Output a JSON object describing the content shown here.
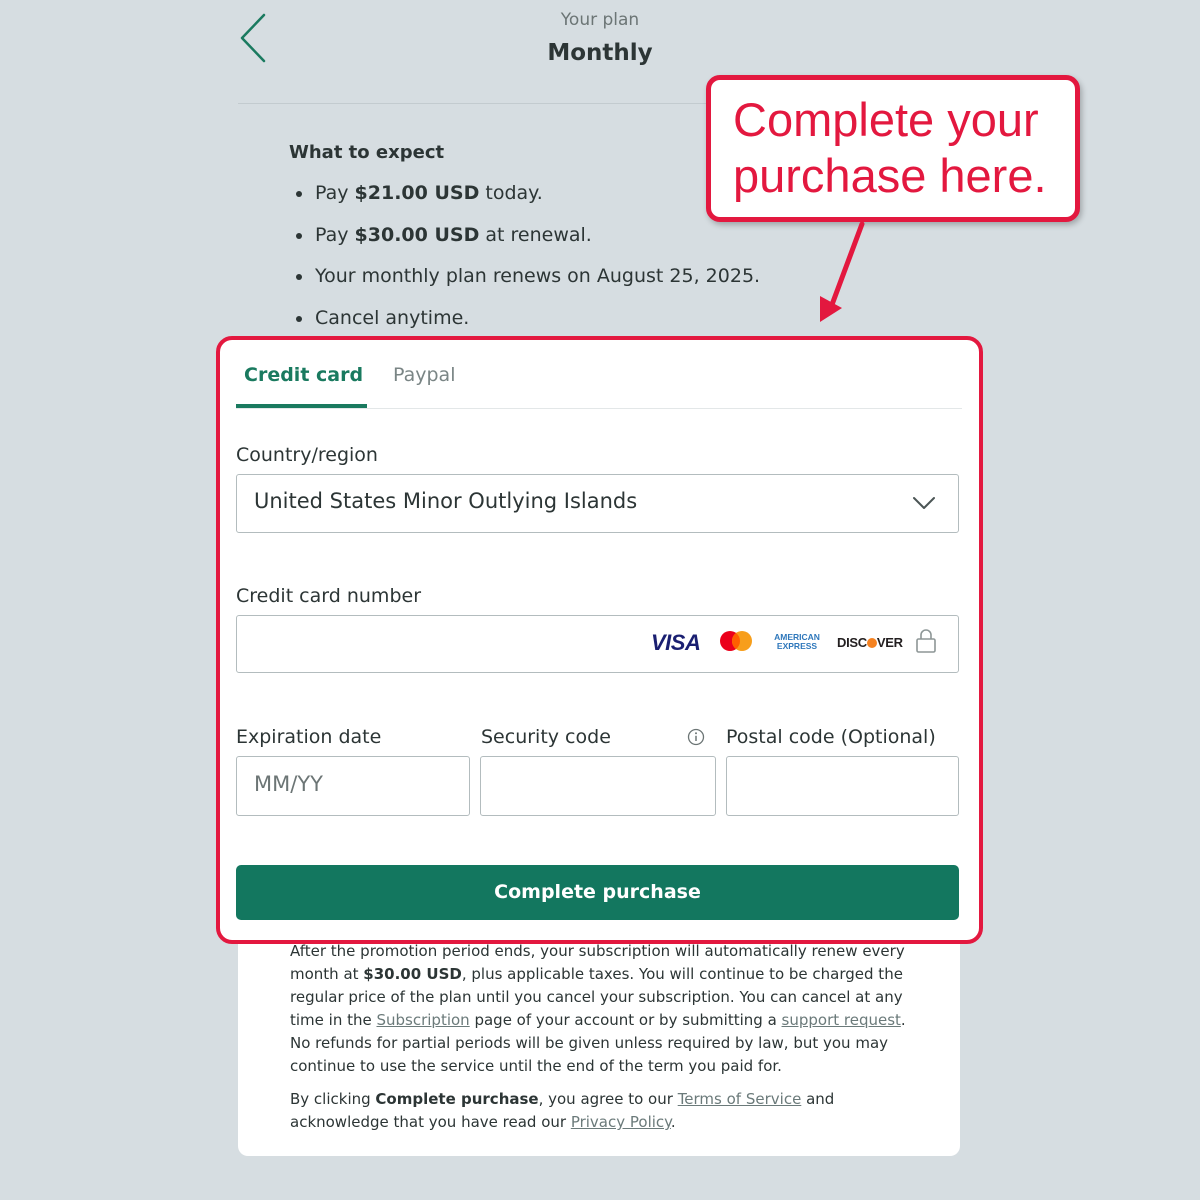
{
  "header": {
    "subtitle": "Your plan",
    "title": "Monthly"
  },
  "expectations": {
    "heading": "What to expect",
    "items": [
      {
        "pre": "Pay ",
        "bold": "$21.00 USD",
        "post": " today."
      },
      {
        "pre": "Pay ",
        "bold": "$30.00 USD",
        "post": " at renewal."
      },
      {
        "pre": "Your monthly plan renews on August 25, 2025.",
        "bold": "",
        "post": ""
      },
      {
        "pre": "Cancel anytime.",
        "bold": "",
        "post": ""
      }
    ]
  },
  "callout": {
    "line1": "Complete your",
    "line2": "purchase here."
  },
  "payment": {
    "tabs": [
      {
        "label": "Credit card",
        "active": true
      },
      {
        "label": "Paypal",
        "active": false
      }
    ],
    "country_label": "Country/region",
    "country_value": "United States Minor Outlying Islands",
    "card_number_label": "Credit card number",
    "card_brands": {
      "visa": "VISA",
      "amex_line1": "AMERICAN",
      "amex_line2": "EXPRESS",
      "discover_pre": "DISC",
      "discover_post": "VER"
    },
    "expiration_label": "Expiration date",
    "expiration_placeholder": "MM/YY",
    "security_label": "Security code",
    "postal_label": "Postal code (Optional)",
    "purchase_button": "Complete purchase"
  },
  "legal": {
    "p1_a": "After the promotion period ends, your subscription will automatically renew every month at ",
    "p1_b": "$30.00 USD",
    "p1_c": ", plus applicable taxes. You will continue to be charged the regular price of the plan until you cancel your subscription. You can cancel at any time in the ",
    "p1_link1": "Subscription",
    "p1_d": " page of your account or by submitting a ",
    "p1_link2": "support request",
    "p1_e": ". No refunds for partial periods will be given unless required by law, but you may continue to use the service until the end of the term you paid for.",
    "p2_a": "By clicking ",
    "p2_b": "Complete purchase",
    "p2_c": ", you agree to our ",
    "p2_link1": "Terms of Service",
    "p2_d": " and acknowledge that you have read our ",
    "p2_link2": "Privacy Policy",
    "p2_e": "."
  },
  "colors": {
    "accent_green": "#13775f",
    "callout_red": "#e3183f",
    "background": "#d6dde1"
  }
}
